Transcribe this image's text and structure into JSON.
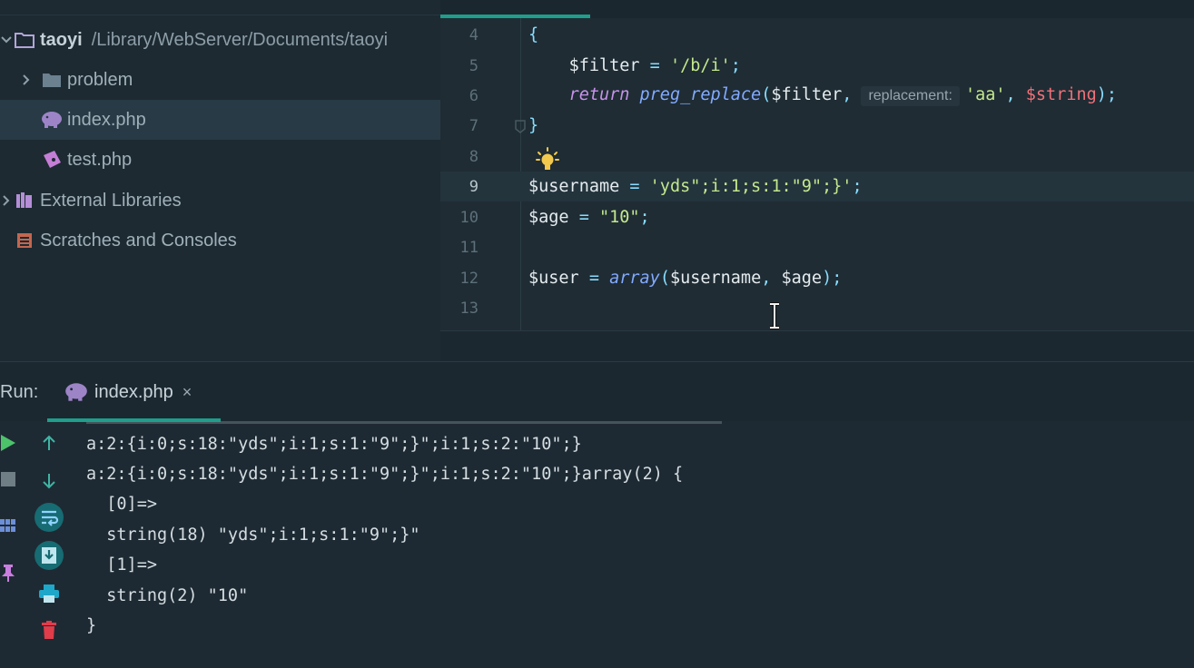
{
  "project": {
    "root_name": "taoyi",
    "root_path": "/Library/WebServer/Documents/taoyi",
    "items": [
      {
        "label": "problem",
        "icon": "folder-icon"
      },
      {
        "label": "index.php",
        "icon": "php-elephant-icon"
      },
      {
        "label": "test.php",
        "icon": "php-file-icon"
      }
    ],
    "external_libraries": "External Libraries",
    "scratches": "Scratches and Consoles"
  },
  "editor": {
    "line_numbers": [
      "4",
      "5",
      "6",
      "7",
      "8",
      "9",
      "10",
      "11",
      "12",
      "13"
    ],
    "current_line": "9",
    "code": {
      "l4": "{",
      "l5_var": "$filter",
      "l5_eq": " = ",
      "l5_str": "'/b/i'",
      "l5_end": ";",
      "l6_kw": "return",
      "l6_fn": "preg_replace",
      "l6_open": "(",
      "l6_arg1": "$filter",
      "l6_comma": ",",
      "l6_hint": "replacement:",
      "l6_str": "'aa'",
      "l6_comma2": ", ",
      "l6_arg3": "$string",
      "l6_close": ");",
      "l7": "}",
      "l9_var": "$username",
      "l9_eq": " = ",
      "l9_str": "'yds\";i:1;s:1:\"9\";}'",
      "l9_end": ";",
      "l10_var": "$age",
      "l10_eq": " = ",
      "l10_str": "\"10\"",
      "l10_end": ";",
      "l12_var": "$user",
      "l12_eq": " = ",
      "l12_fn": "array",
      "l12_open": "(",
      "l12_arg1": "$username",
      "l12_comma": ", ",
      "l12_arg2": "$age",
      "l12_close": ");"
    }
  },
  "run": {
    "label": "Run:",
    "tab_title": "index.php",
    "tab_close": "×",
    "output": [
      "a:2:{i:0;s:18:\"yds\";i:1;s:1:\"9\";}\";i:1;s:2:\"10\";}",
      "a:2:{i:0;s:18:\"yds\";i:1;s:1:\"9\";}\";i:1;s:2:\"10\";}array(2) {",
      "  [0]=>",
      "  string(18) \"yds\";i:1;s:1:\"9\";}\"",
      "  [1]=>",
      "  string(2) \"10\"",
      "}"
    ],
    "toolbar": [
      "play-icon",
      "up-arrow-icon",
      "stop-icon",
      "down-arrow-icon",
      "layout-icon",
      "soft-wrap-icon",
      "pin-icon",
      "scroll-to-end-icon",
      "print-icon",
      "trash-icon"
    ]
  },
  "colors": {
    "accent": "#1f9e8b",
    "string": "#c3e88d",
    "function": "#82aaff",
    "keyword": "#c792ea",
    "variable_param": "#f07178"
  }
}
